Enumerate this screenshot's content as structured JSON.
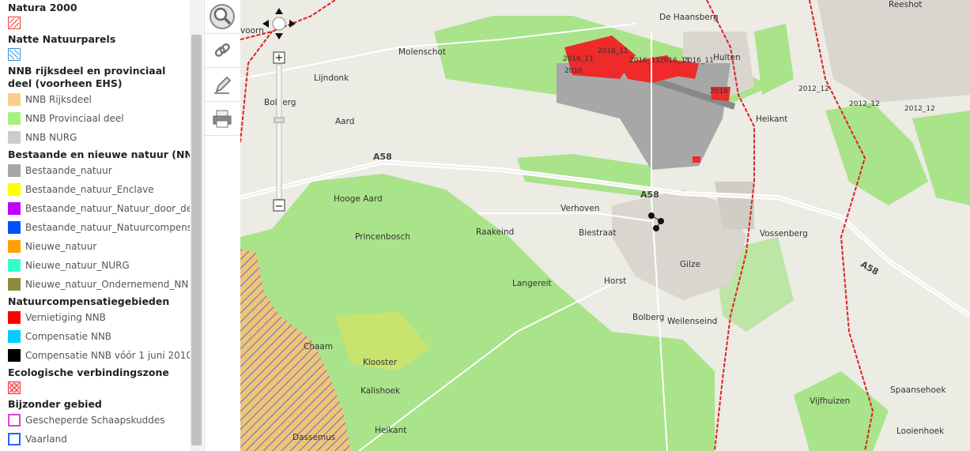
{
  "legend": {
    "natura2000": "Natura 2000",
    "natte": "Natte Natuurparels",
    "nnb_heading": "NNB rijksdeel en provinciaal deel (voorheen EHS)",
    "nnb_items": [
      {
        "label": "NNB Rijksdeel",
        "color": "#f9d08b"
      },
      {
        "label": "NNB Provinciaal deel",
        "color": "#a8f07c"
      },
      {
        "label": "NNB NURG",
        "color": "#cccccc"
      }
    ],
    "bestaande_heading": "Bestaande en nieuwe natuur (NNB",
    "bestaande_items": [
      {
        "label": "Bestaande_natuur",
        "color": "#a6a6a6"
      },
      {
        "label": "Bestaande_natuur_Enclave",
        "color": "#ffff00"
      },
      {
        "label": "Bestaande_natuur_Natuur_door_de",
        "color": "#c000ff"
      },
      {
        "label": "Bestaande_natuur_Natuurcompens",
        "color": "#0050ff"
      },
      {
        "label": "Nieuwe_natuur",
        "color": "#ffa000"
      },
      {
        "label": "Nieuwe_natuur_NURG",
        "color": "#33ffcc"
      },
      {
        "label": "Nieuwe_natuur_Ondernemend_NN",
        "color": "#8c8c3c"
      }
    ],
    "comp_heading": "Natuurcompensatiegebieden",
    "comp_items": [
      {
        "label": "Vernietiging NNB",
        "color": "#ff0000"
      },
      {
        "label": "Compensatie NNB",
        "color": "#00ccff"
      },
      {
        "label": "Compensatie NNB vóór 1 juni 2010",
        "color": "#000000"
      }
    ],
    "eco_heading": "Ecologische verbindingszone",
    "bijzonder_heading": "Bijzonder gebied",
    "bijzonder_items": [
      {
        "label": "Gescheperde Schaapskuddes",
        "color": "#e040e0"
      },
      {
        "label": "Vaarland",
        "color": "#1e64ff"
      }
    ]
  },
  "tools": [
    "zoom-tool-icon",
    "link-icon",
    "edit-icon",
    "print-icon"
  ],
  "map": {
    "places": [
      "De Haansberg",
      "Molenschot",
      "Hulten",
      "Lijndonk",
      "Bolberg",
      "Hooge Aard",
      "Heikant",
      "Verhoven",
      "Princenbosch",
      "Raakeind",
      "Biestraat",
      "Gilze",
      "Vossenberg",
      "Langereit",
      "Horst",
      "Bolberg",
      "Weilenseind",
      "Chaam",
      "Klooster",
      "Kalishoek",
      "Heikant",
      "Dassemus",
      "Vijfhuizen",
      "Spaanseh​oek",
      "Looienhoek",
      "Reeshot",
      "voorn",
      "Aard"
    ],
    "roads": [
      "A58",
      "A58",
      "A58"
    ],
    "labels_2016": [
      "2016_11",
      "2016_11",
      "2016_11",
      "2016",
      "2016_11",
      "2016_11",
      "2016"
    ],
    "labels_2012": [
      "2012_12",
      "2012_12",
      "2012_12"
    ]
  }
}
